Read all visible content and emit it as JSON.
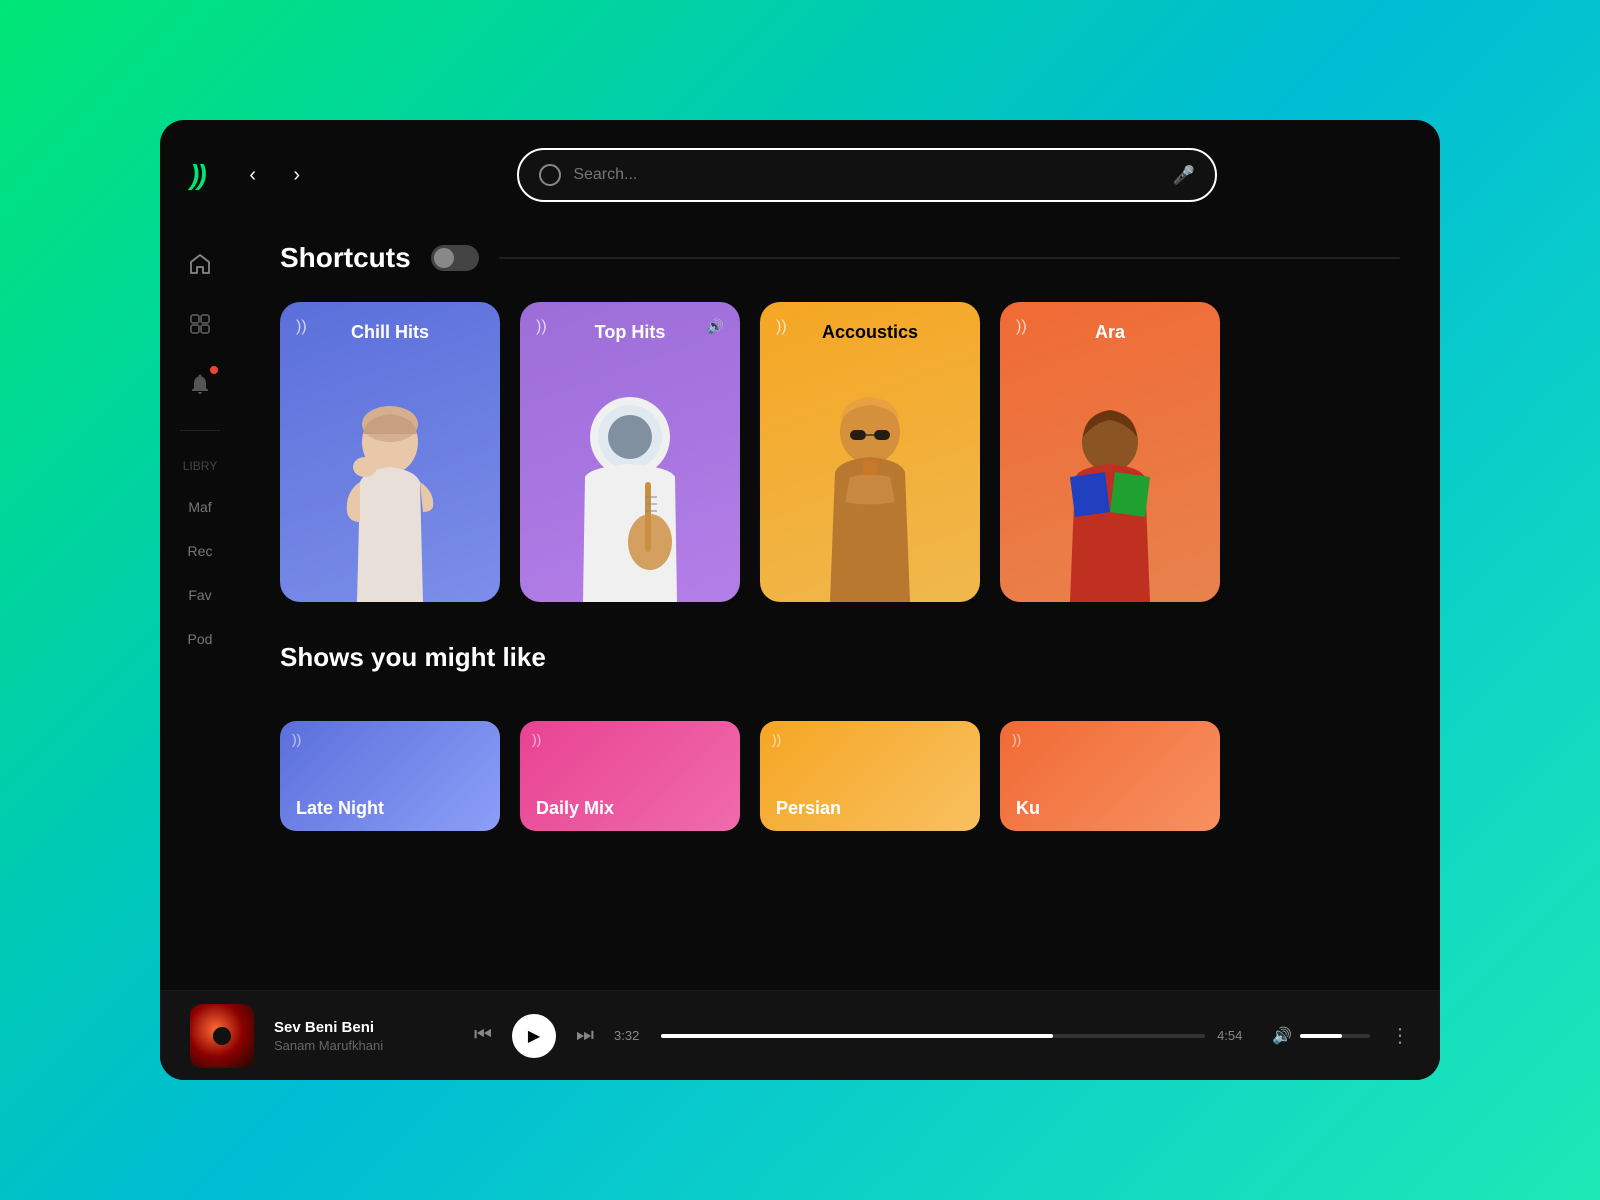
{
  "app": {
    "logo": "))",
    "nav": {
      "back_arrow": "‹",
      "forward_arrow": "›"
    }
  },
  "search": {
    "placeholder": "Search..."
  },
  "sidebar": {
    "icons": [
      "home",
      "playlist",
      "notifications"
    ],
    "library_label": "LIBRY",
    "nav_items": [
      {
        "label": "Maf",
        "name": "maf"
      },
      {
        "label": "Rec",
        "name": "rec"
      },
      {
        "label": "Fav",
        "name": "fav"
      },
      {
        "label": "Pod",
        "name": "pod"
      }
    ]
  },
  "shortcuts": {
    "title": "Shortcuts",
    "cards": [
      {
        "id": "chill-hits",
        "label": "Chill Hits",
        "color_class": "card-chill"
      },
      {
        "id": "top-hits",
        "label": "Top Hits",
        "color_class": "card-top",
        "active": true
      },
      {
        "id": "acoustics",
        "label": "Accoustics",
        "color_class": "card-acoustics"
      },
      {
        "id": "arabic",
        "label": "Ara",
        "color_class": "card-arabic"
      }
    ]
  },
  "shows_section": {
    "title": "Shows you might like",
    "cards": [
      {
        "id": "late-night",
        "label": "Late Night",
        "color_class": "card-late-night"
      },
      {
        "id": "daily-mix",
        "label": "Daily Mix",
        "color_class": "card-daily-mix"
      },
      {
        "id": "persian",
        "label": "Persian",
        "color_class": "card-persian"
      },
      {
        "id": "ku",
        "label": "Ku",
        "color_class": "card-ku"
      }
    ]
  },
  "player": {
    "track_name": "Sev Beni Beni",
    "artist_name": "Sanam Marufkhani",
    "current_time": "3:32",
    "total_time": "4:54",
    "progress_percent": 72
  }
}
